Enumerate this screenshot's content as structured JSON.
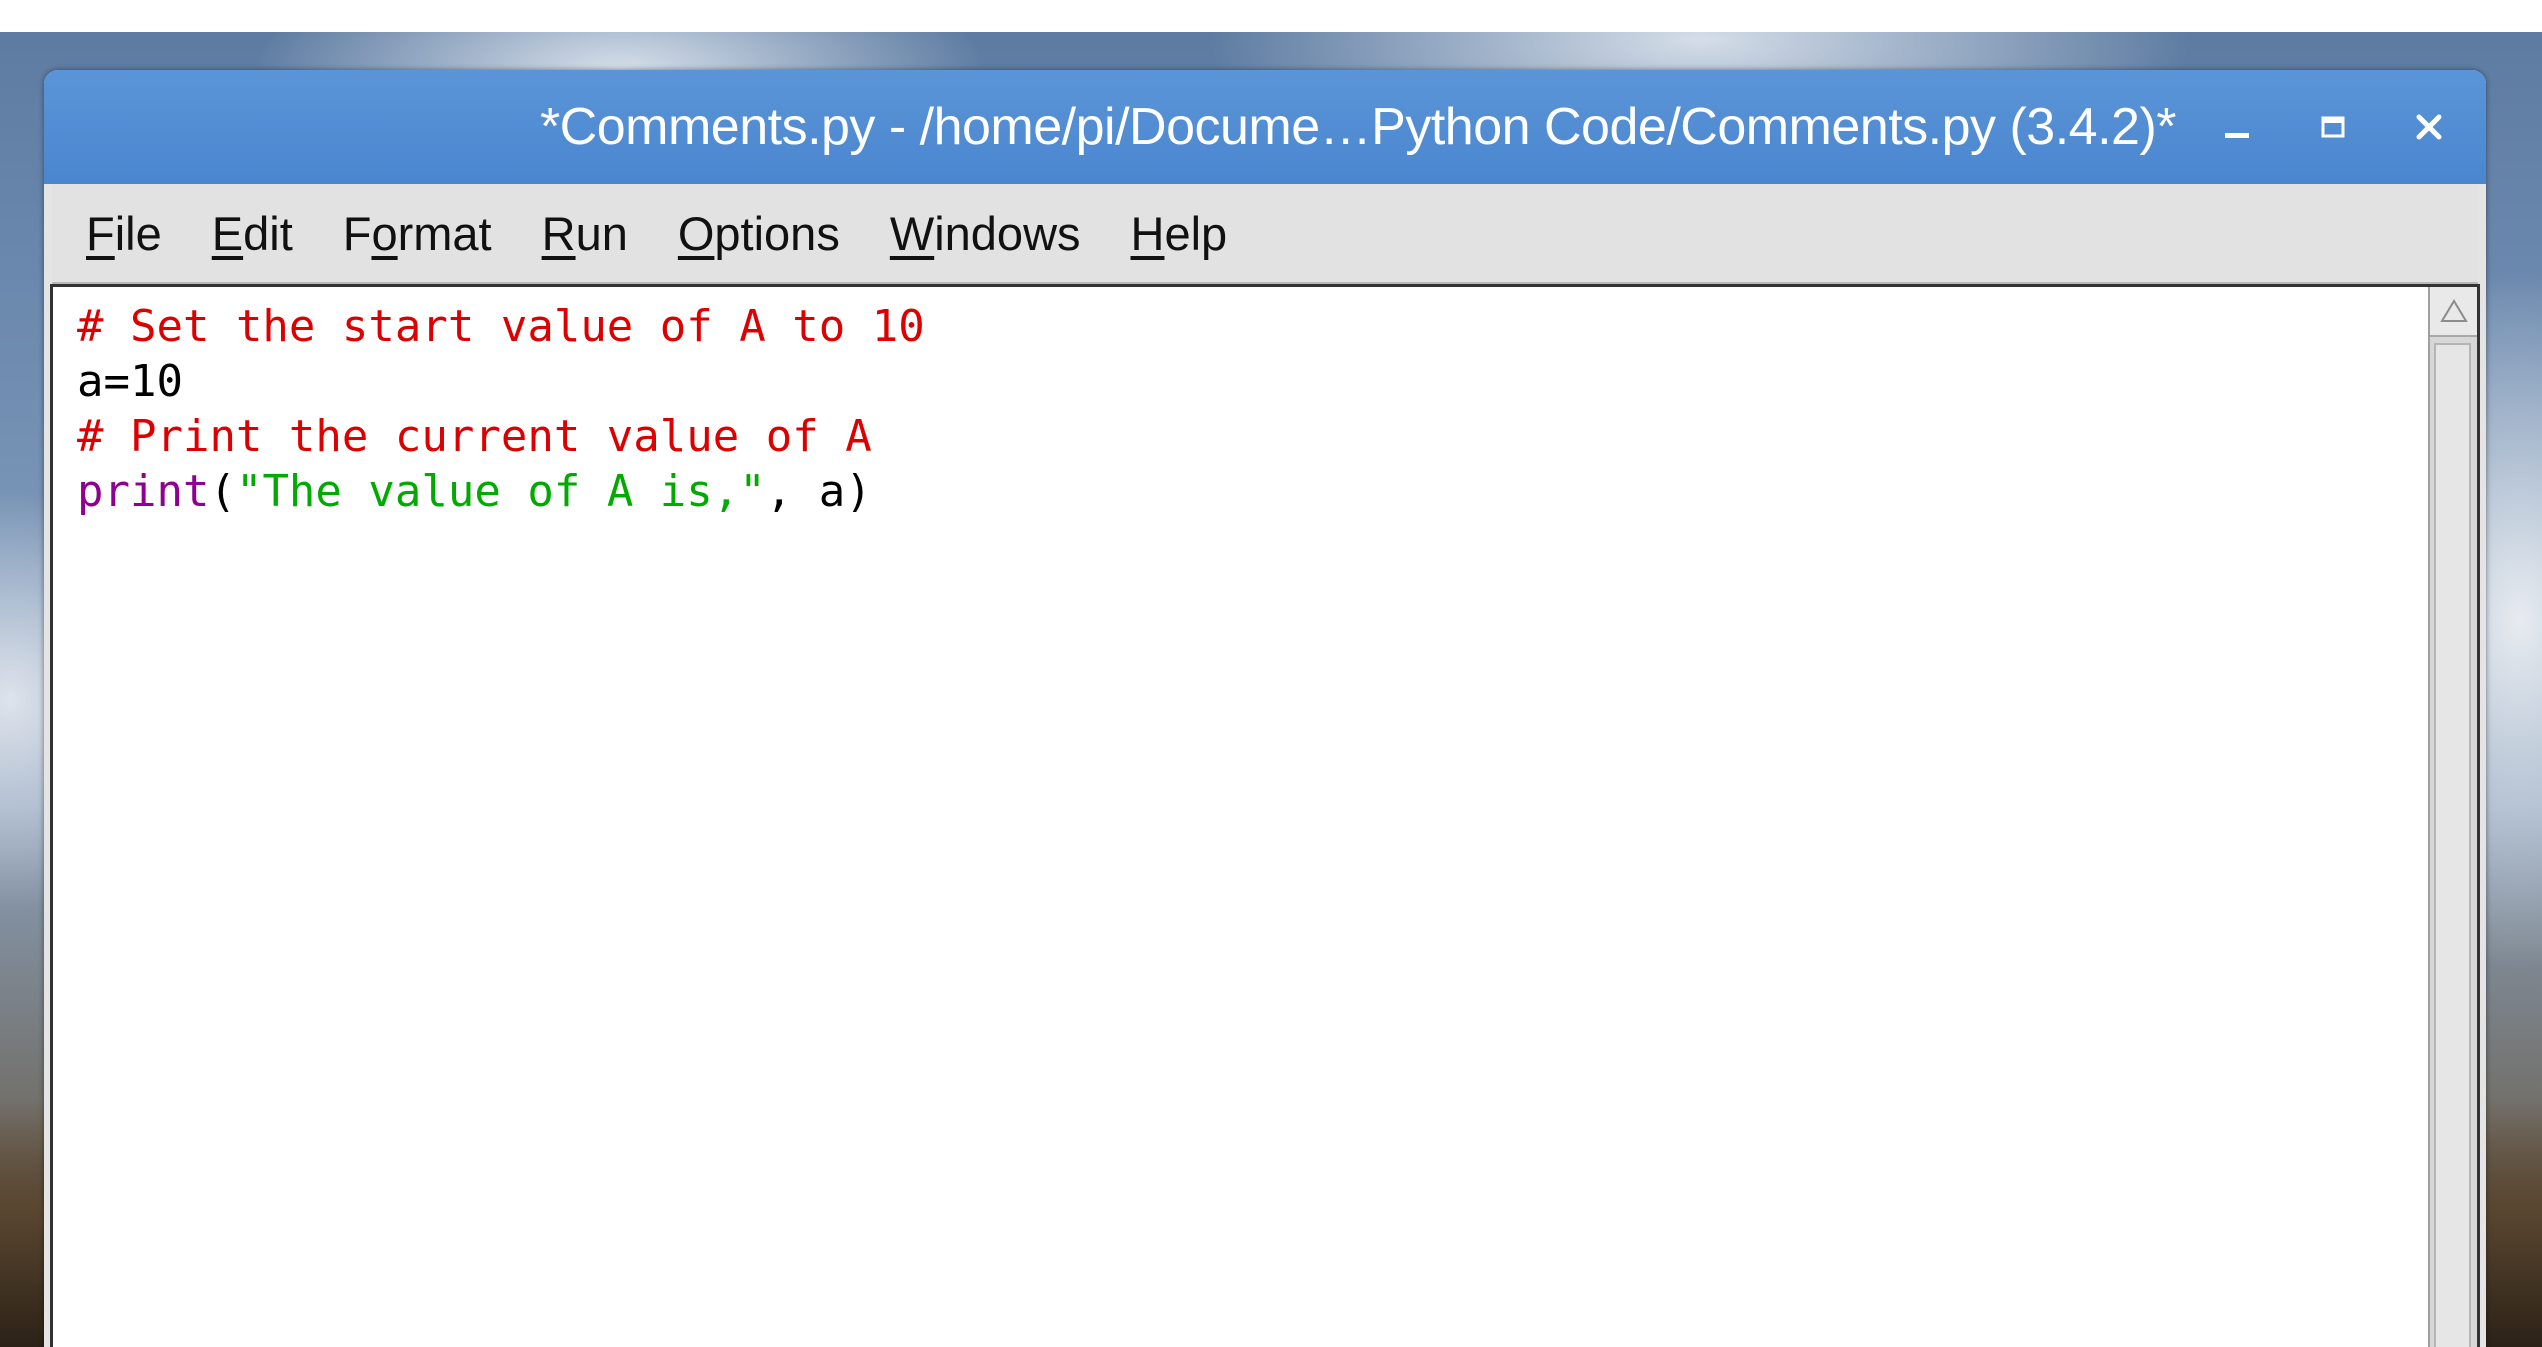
{
  "window": {
    "title": "*Comments.py - /home/pi/Docume…Python Code/Comments.py (3.4.2)*"
  },
  "window_controls": {
    "minimize_icon": "minimize-icon",
    "maximize_icon": "maximize-icon",
    "close_icon": "close-icon"
  },
  "menu": {
    "items": [
      {
        "pre": "",
        "u": "F",
        "post": "ile"
      },
      {
        "pre": "",
        "u": "E",
        "post": "dit"
      },
      {
        "pre": "F",
        "u": "o",
        "post": "rmat"
      },
      {
        "pre": "",
        "u": "R",
        "post": "un"
      },
      {
        "pre": "",
        "u": "O",
        "post": "ptions"
      },
      {
        "pre": "",
        "u": "W",
        "post": "indows"
      },
      {
        "pre": "",
        "u": "H",
        "post": "elp"
      }
    ]
  },
  "editor": {
    "lines": [
      [
        {
          "text": "# Set the start value of A to 10",
          "kind": "comment"
        }
      ],
      [
        {
          "text": "a=10",
          "kind": "plain"
        }
      ],
      [
        {
          "text": "# Print the current value of A",
          "kind": "comment"
        }
      ],
      [
        {
          "text": "print",
          "kind": "builtin"
        },
        {
          "text": "(",
          "kind": "plain"
        },
        {
          "text": "\"The value of A is,\"",
          "kind": "string"
        },
        {
          "text": ", a)",
          "kind": "plain"
        }
      ]
    ]
  },
  "colors": {
    "titlebar": "#4a86cf",
    "comment": "#dd0000",
    "plain": "#000000",
    "builtin": "#900090",
    "string": "#00aa00",
    "menu_text": "#111111"
  }
}
